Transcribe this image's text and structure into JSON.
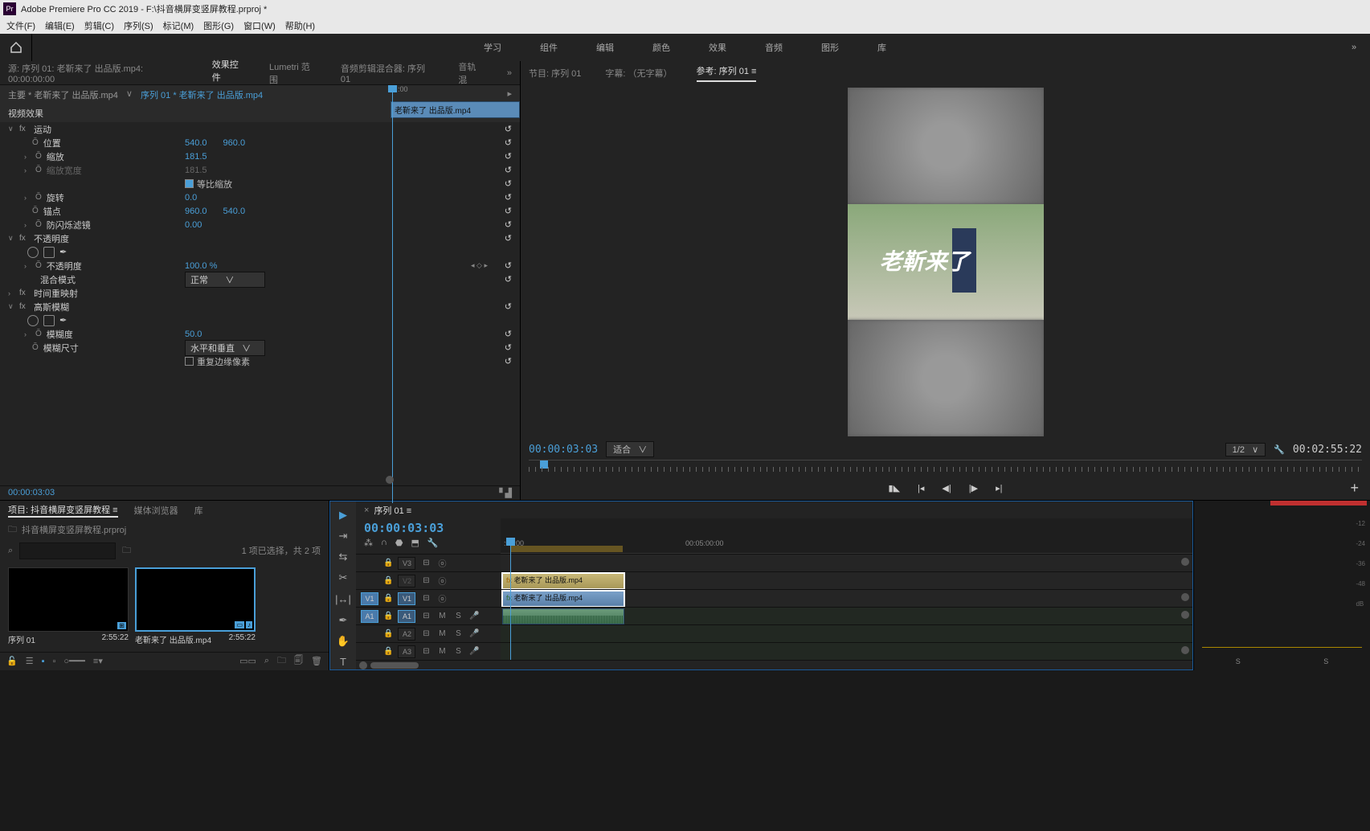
{
  "title": "Adobe Premiere Pro CC 2019 - F:\\抖音横屏变竖屏教程.prproj *",
  "menu": [
    "文件(F)",
    "编辑(E)",
    "剪辑(C)",
    "序列(S)",
    "标记(M)",
    "图形(G)",
    "窗口(W)",
    "帮助(H)"
  ],
  "workspaces": [
    "学习",
    "组件",
    "编辑",
    "颜色",
    "效果",
    "音频",
    "图形",
    "库"
  ],
  "source": {
    "label": "源: 序列 01: 老靳来了 出品版.mp4: 00:00:00:00",
    "tabs": [
      "效果控件",
      "Lumetri 范围",
      "音频剪辑混合器: 序列 01",
      "音轨混"
    ],
    "master": "主要 * 老靳来了 出品版.mp4",
    "clip_link": "序列 01 * 老靳来了 出品版.mp4",
    "mini_clip": "老靳来了 出品版.mp4",
    "section_video": "视频效果",
    "motion": {
      "name": "运动",
      "position_label": "位置",
      "position_x": "540.0",
      "position_y": "960.0",
      "scale_label": "缩放",
      "scale": "181.5",
      "scale_w_label": "缩放宽度",
      "scale_w": "181.5",
      "uniform": "等比缩放",
      "rotation_label": "旋转",
      "rotation": "0.0",
      "anchor_label": "锚点",
      "anchor_x": "960.0",
      "anchor_y": "540.0",
      "flicker_label": "防闪烁滤镜",
      "flicker": "0.00"
    },
    "opacity": {
      "name": "不透明度",
      "opacity_label": "不透明度",
      "opacity": "100.0 %",
      "blend_label": "混合模式",
      "blend": "正常"
    },
    "time": {
      "name": "时间重映射"
    },
    "blur": {
      "name": "高斯模糊",
      "amount_label": "模糊度",
      "amount": "50.0",
      "dim_label": "模糊尺寸",
      "dim": "水平和垂直",
      "repeat": "重复边缘像素"
    },
    "tc": "00:00:03:03"
  },
  "program": {
    "tabs": {
      "a": "节目: 序列 01",
      "b": "字幕: （无字幕）",
      "c": "参考: 序列 01"
    },
    "overlay_text": "老靳来了",
    "tc": "00:00:03:03",
    "fit": "适合",
    "zoom": "1/2",
    "duration": "00:02:55:22"
  },
  "project": {
    "tabs": [
      "项目: 抖音横屏变竖屏教程",
      "媒体浏览器",
      "库"
    ],
    "path": "抖音横屏变竖屏教程.prproj",
    "search_placeholder": "",
    "count": "1 项已选择，共 2 项",
    "items": [
      {
        "name": "序列 01",
        "dur": "2:55:22"
      },
      {
        "name": "老靳来了 出品版.mp4",
        "dur": "2:55:22"
      }
    ]
  },
  "timeline": {
    "seq": "序列 01",
    "tc": "00:00:03:03",
    "ruler": {
      "t0": ":00:00",
      "t1": "00:05:00:00"
    },
    "tracks": {
      "v3": "V3",
      "v2": "V2",
      "v1": "V1",
      "a1": "A1",
      "a2": "A2",
      "a3": "A3"
    },
    "src": {
      "v1": "V1",
      "a1": "A1"
    },
    "toggles": {
      "m": "M",
      "s": "S"
    },
    "clip_v2": "老靳来了 出品版.mp4",
    "clip_v1": "老靳来了 出品版.mp4"
  },
  "meter": {
    "s": "S",
    "levels": [
      "-12",
      "-24",
      "-36",
      "-48",
      "dB"
    ]
  }
}
